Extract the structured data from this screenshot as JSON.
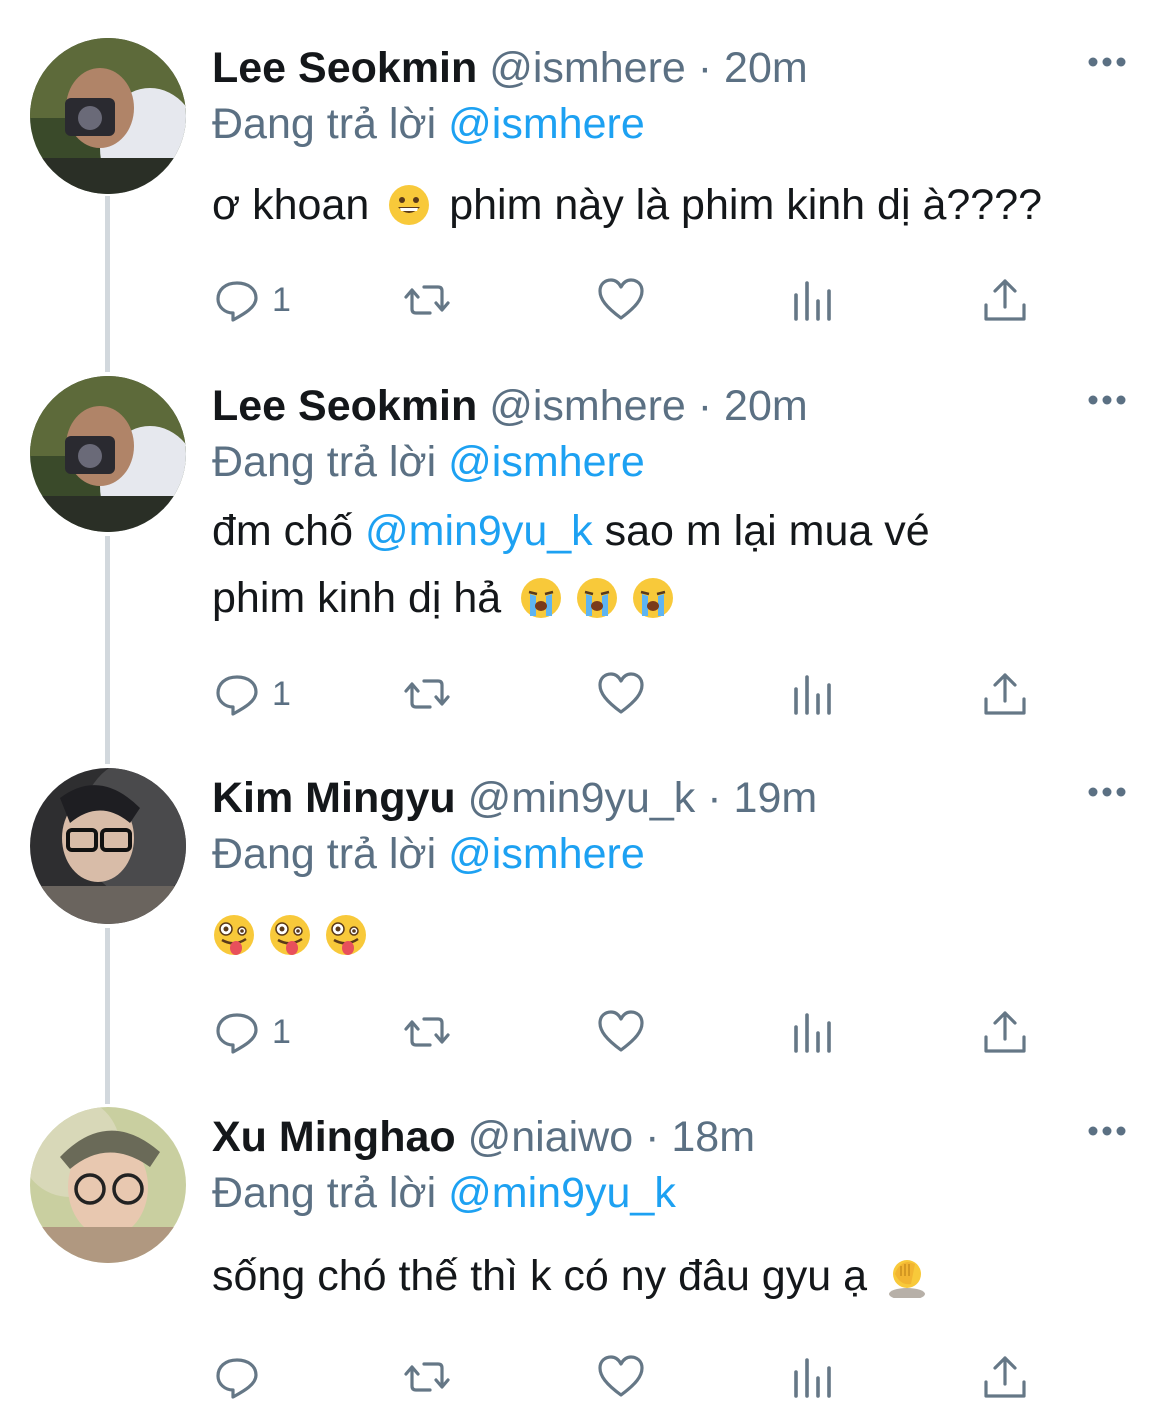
{
  "tweets": [
    {
      "name": "Lee Seokmin",
      "handle": "@ismhere",
      "sep": "·",
      "time": "20m",
      "reply_label": "Đang trả lời",
      "reply_to": "@ismhere",
      "text_a": "ơ khoan",
      "text_b": "phim này là phim kinh dị à????",
      "reply_count": "1"
    },
    {
      "name": "Lee Seokmin",
      "handle": "@ismhere",
      "sep": "·",
      "time": "20m",
      "reply_label": "Đang trả lời",
      "reply_to": "@ismhere",
      "text_a": "đm chố",
      "text_mention": "@min9yu_k",
      "text_b": "sao m lại mua vé",
      "text_c": "phim kinh dị hả",
      "reply_count": "1"
    },
    {
      "name": "Kim Mingyu",
      "handle": "@min9yu_k",
      "sep": "·",
      "time": "19m",
      "reply_label": "Đang trả lời",
      "reply_to": "@ismhere",
      "reply_count": "1"
    },
    {
      "name": "Xu Minghao",
      "handle": "@niaiwo",
      "sep": "·",
      "time": "18m",
      "reply_label": "Đang trả lời",
      "reply_to": "@min9yu_k",
      "text_a": "sống chó thế thì k có ny đâu gyu ạ",
      "reply_count": ""
    }
  ],
  "icons": {
    "reply": "reply-icon",
    "retweet": "retweet-icon",
    "like": "heart-icon",
    "analytics": "analytics-icon",
    "share": "share-icon",
    "more": "more-icon"
  },
  "colors": {
    "mention": "#1da1f2",
    "secondary": "#5b7083",
    "icon": "#657786",
    "thread_line": "#d2d8dd"
  }
}
